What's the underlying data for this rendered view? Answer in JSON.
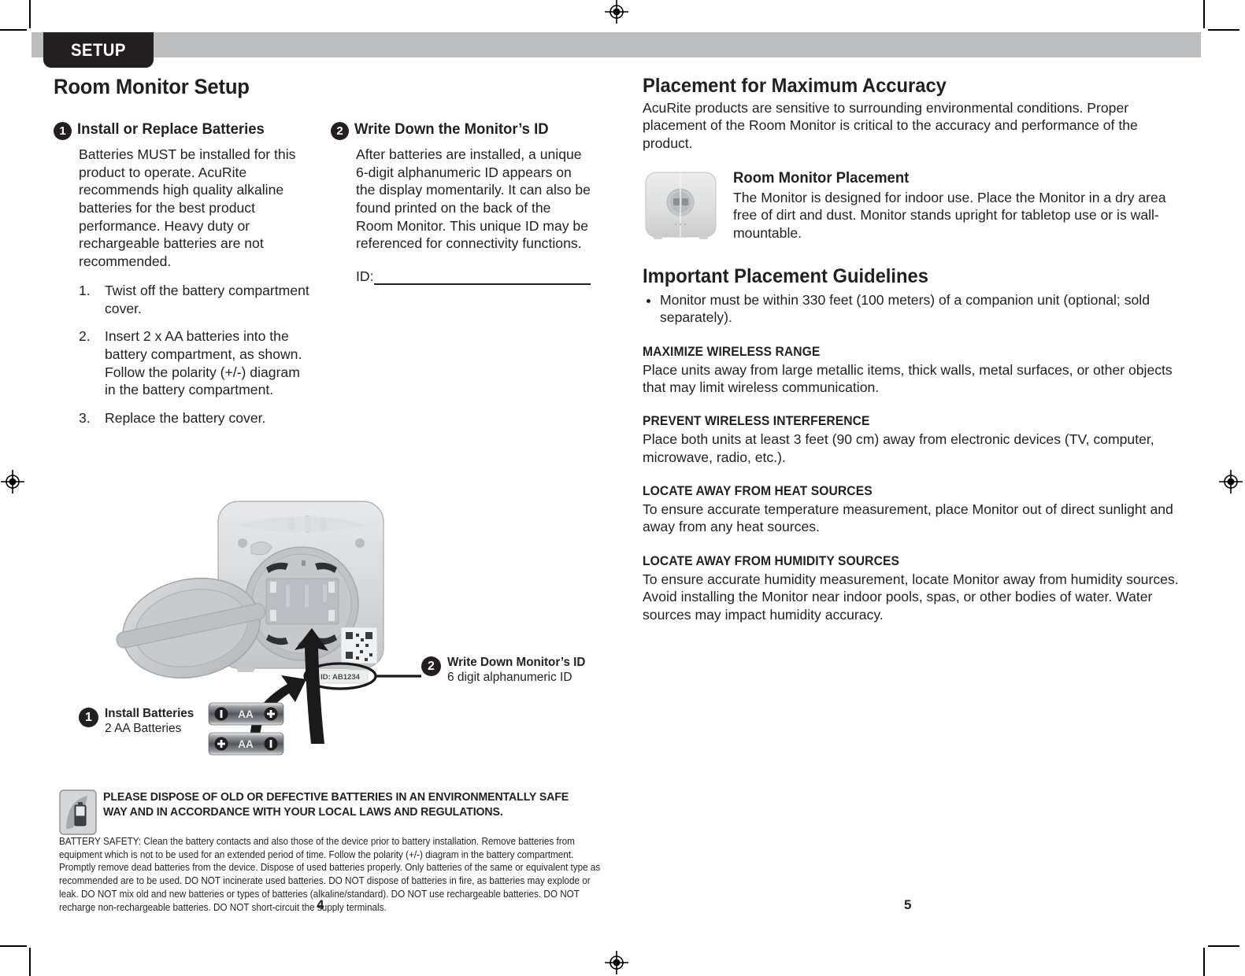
{
  "header": {
    "tab_label": "SETUP",
    "band_color": "#bcbec0",
    "tab_color": "#231f20"
  },
  "left_page": {
    "title": "Room Monitor Setup",
    "folio": "4",
    "step1": {
      "number": "1",
      "title": "Install or Replace Batteries",
      "intro": "Batteries MUST be installed for this product to operate. AcuRite recommends high quality alkaline batteries for the best product performance. Heavy duty or rechargeable batteries are not recommended.",
      "items": [
        {
          "num": "1.",
          "text": "Twist off the battery compartment cover."
        },
        {
          "num": "2.",
          "text": "Insert 2 x AA batteries into the battery compartment, as shown. Follow the polarity (+/-) diagram in the battery compartment."
        },
        {
          "num": "3.",
          "text": "Replace the battery cover."
        }
      ]
    },
    "step2": {
      "number": "2",
      "title": "Write Down the Monitor’s ID",
      "intro": "After batteries are installed, a unique 6-digit alphanumeric ID appears on the display momentarily. It can also be found printed on the back of the Room Monitor. This unique ID may be referenced for connectivity functions.",
      "id_label": "ID:"
    },
    "diagram": {
      "id_sticker": "ID: AB1234",
      "battery_label": "AA",
      "callout1": {
        "number": "1",
        "title": "Install Batteries",
        "subtitle": "2 AA Batteries"
      },
      "callout2": {
        "number": "2",
        "title": "Write Down Monitor’s ID",
        "subtitle": "6 digit alphanumeric ID"
      }
    },
    "warning": {
      "heading": "PLEASE DISPOSE OF OLD OR DEFECTIVE BATTERIES IN AN ENVIRONMENTALLY SAFE WAY AND IN ACCORDANCE WITH YOUR LOCAL LAWS AND REGULATIONS.",
      "fine_print": "BATTERY SAFETY: Clean the battery contacts and also those of the device prior to battery installation. Remove batteries from equipment which is not to be used for an extended period of time. Follow the polarity (+/-) diagram in the battery compartment. Promptly remove dead batteries from the device. Dispose of used batteries properly. Only batteries of the same or equivalent type as recommended are to be used. DO NOT incinerate used batteries. DO NOT dispose of batteries in fire, as batteries may explode or leak. DO NOT mix old and new batteries or types of batteries (alkaline/standard). DO NOT use rechargeable batteries. DO NOT recharge non-rechargeable batteries. DO NOT short-circuit the supply terminals."
    }
  },
  "right_page": {
    "folio": "5",
    "accuracy": {
      "title": "Placement for Maximum Accuracy",
      "body": "AcuRite products are sensitive to surrounding environmental conditions. Proper placement of the Room Monitor is critical to the accuracy and performance of the product."
    },
    "placement": {
      "title": "Room Monitor Placement",
      "body": "The Monitor is designed for indoor use. Place the Monitor in a dry area free of dirt and dust. Monitor stands upright for tabletop use or is wall-mountable."
    },
    "guidelines": {
      "title": "Important Placement Guidelines",
      "bullets": [
        "Monitor must be within 330 feet (100 meters) of a companion unit (optional; sold separately)."
      ],
      "sections": [
        {
          "heading": "MAXIMIZE WIRELESS RANGE",
          "body": "Place units away from large metallic items, thick walls, metal surfaces, or other objects that may limit wireless communication."
        },
        {
          "heading": "PREVENT WIRELESS INTERFERENCE",
          "body": "Place both units at least 3 feet (90 cm) away from electronic devices (TV, computer, microwave, radio, etc.)."
        },
        {
          "heading": "LOCATE AWAY FROM HEAT SOURCES",
          "body": "To ensure accurate temperature measurement, place Monitor out of direct sunlight and away from any heat sources."
        },
        {
          "heading": "LOCATE AWAY FROM HUMIDITY SOURCES",
          "body": "To ensure accurate humidity measurement, locate Monitor away from humidity sources. Avoid installing the Monitor near indoor pools, spas, or other bodies of water. Water sources may impact humidity accuracy."
        }
      ]
    }
  }
}
